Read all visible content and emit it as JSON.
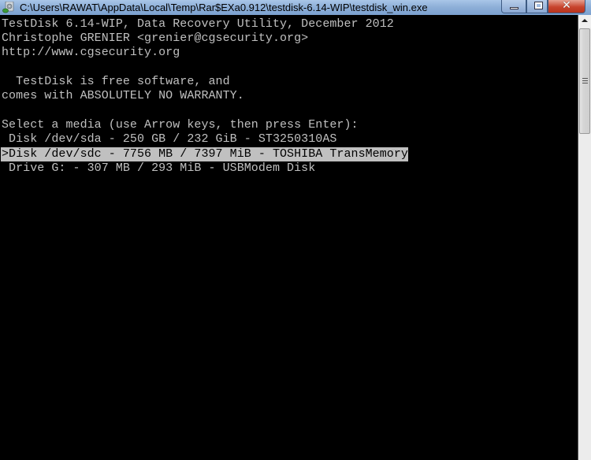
{
  "window": {
    "title": "C:\\Users\\RAWAT\\AppData\\Local\\Temp\\Rar$EXa0.912\\testdisk-6.14-WIP\\testdisk_win.exe",
    "icon": "console-app-icon",
    "buttons": {
      "minimize": "minimize-icon",
      "maximize": "maximize-icon",
      "close": "close-icon"
    },
    "colors": {
      "titlebar": "#8fb0d8",
      "close_button": "#c8452e",
      "console_bg": "#000000",
      "console_fg": "#c0c0c0",
      "selection_bg": "#c0c0c0"
    }
  },
  "console": {
    "header": [
      "TestDisk 6.14-WIP, Data Recovery Utility, December 2012",
      "Christophe GRENIER <grenier@cgsecurity.org>",
      "http://www.cgsecurity.org"
    ],
    "license": [
      "  TestDisk is free software, and",
      "comes with ABSOLUTELY NO WARRANTY."
    ],
    "prompt": "Select a media (use Arrow keys, then press Enter):",
    "media": [
      {
        "text": " Disk /dev/sda - 250 GB / 232 GiB - ST3250310AS",
        "selected": false
      },
      {
        "text": ">Disk /dev/sdc - 7756 MB / 7397 MiB - TOSHIBA TransMemory",
        "selected": true
      },
      {
        "text": " Drive G: - 307 MB / 293 MiB - USBModem Disk",
        "selected": false
      }
    ]
  }
}
